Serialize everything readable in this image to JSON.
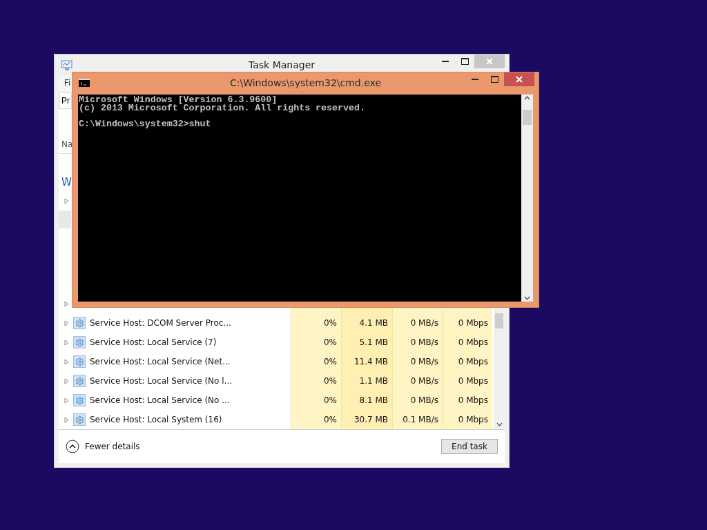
{
  "task_manager": {
    "title": "Task Manager",
    "menu": [
      "Fi"
    ],
    "tabs": [
      {
        "label": "Pr",
        "selected": true
      }
    ],
    "column_header": "Na",
    "group": "W",
    "rows": [
      {
        "name": "Service Host: DCOM Server Proc...",
        "cpu": "0%",
        "memory": "4.1 MB",
        "disk": "0 MB/s",
        "network": "0 Mbps"
      },
      {
        "name": "Service Host: Local Service (7)",
        "cpu": "0%",
        "memory": "5.1 MB",
        "disk": "0 MB/s",
        "network": "0 Mbps"
      },
      {
        "name": "Service Host: Local Service (Net...",
        "cpu": "0%",
        "memory": "11.4 MB",
        "disk": "0 MB/s",
        "network": "0 Mbps"
      },
      {
        "name": "Service Host: Local Service (No l...",
        "cpu": "0%",
        "memory": "1.1 MB",
        "disk": "0 MB/s",
        "network": "0 Mbps"
      },
      {
        "name": "Service Host: Local Service (No ...",
        "cpu": "0%",
        "memory": "8.1 MB",
        "disk": "0 MB/s",
        "network": "0 Mbps"
      },
      {
        "name": "Service Host: Local System (16)",
        "cpu": "0%",
        "memory": "30.7 MB",
        "disk": "0.1 MB/s",
        "network": "0 Mbps"
      }
    ],
    "fewer_details": "Fewer details",
    "end_task": "End task"
  },
  "cmd": {
    "title": "C:\\Windows\\system32\\cmd.exe",
    "paragraphs": [
      {
        "lines": [
          "Microsoft Windows [Version 6.3.9600]",
          "(c) 2013 Microsoft Corporation. All rights reserved."
        ]
      },
      {
        "lines": [
          "C:\\Windows\\system32>shut"
        ]
      }
    ]
  }
}
